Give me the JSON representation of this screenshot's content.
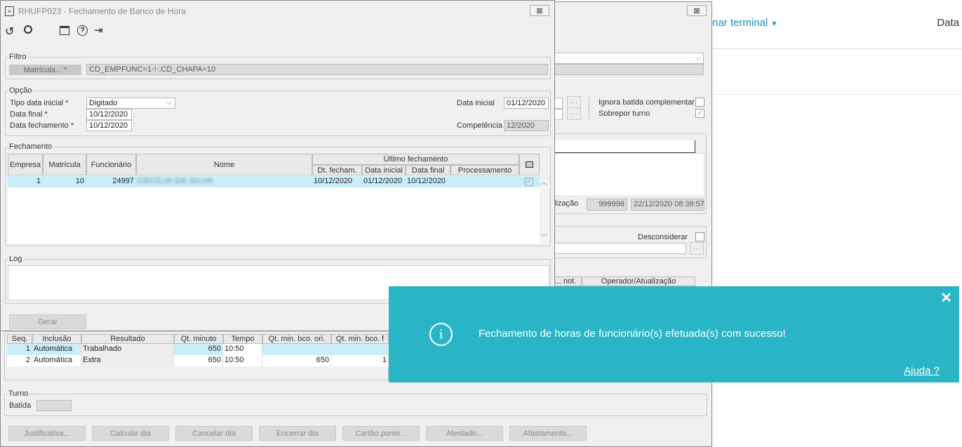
{
  "web": {
    "menu_terminal": "nar terminal",
    "menu_data": "Data"
  },
  "bgwin": {
    "close": "⊠",
    "ignora": "Ignora batida complementar",
    "sobrepor": "Sobrepor turno",
    "atualizacao_label": "lização",
    "operador": "999998",
    "data_atualizacao": "22/12/2020 08:39:57",
    "desconsiderar": "Desconsiderar",
    "col_not": "... not.",
    "col_operador": "Operador/Atualização",
    "seq_header": [
      "Seq.",
      "Inclusão",
      "Resultado",
      "Qt. minuto",
      "Tempo",
      "Qt. min. bco. ori.",
      "Qt. min. bco. f"
    ],
    "seq_rows": [
      [
        "1",
        "Automática",
        "Trabalhado",
        "650",
        "10:50",
        "",
        ""
      ],
      [
        "2",
        "Automática",
        "Extra",
        "650",
        "10:50",
        "650",
        "1"
      ]
    ],
    "turno_legend": "Turno",
    "batida": "Batida",
    "buttons": [
      "Justificativa...",
      "Calcular dia",
      "Cancelar dia",
      "Encerrar dia",
      "Cartão ponto...",
      "Atestado...",
      "Afastamento..."
    ]
  },
  "dialog": {
    "title": "RHUFP023 - Fechamento de Banco de Hora",
    "close": "⊠",
    "filtro": "Filtro",
    "matricula_label": "Matrícula... *",
    "filtro_value": "CD_EMPFUNC=1·!·;CD_CHAPA=10",
    "opcao": "Opção",
    "tipo_label": "Tipo data inicial *",
    "tipo_value": "Digitado",
    "data_final_label": "Data final *",
    "data_final": "10/12/2020",
    "data_fech_label": "Data fechamento *",
    "data_fech": "10/12/2020",
    "data_inicial_label": "Data inicial",
    "data_inicial": "01/12/2020",
    "competencia_label": "Competência",
    "competencia": "12/2020",
    "fechamento": "Fechamento",
    "cols": {
      "empresa": "Empresa",
      "matricula": "Matrícula",
      "funcionario": "Funcionário",
      "nome": "Nome",
      "ultimo": "Último fechamento",
      "dt_fecham": "Dt. fecham.",
      "data_inicial": "Data inicial",
      "data_final": "Data final",
      "processamento": "Processamento"
    },
    "row": {
      "empresa": "1",
      "matricula": "10",
      "funcionario": "24997",
      "nome": "CECÍLIA DA SILVA",
      "dt_fecham": "10/12/2020",
      "data_inicial": "01/12/2020",
      "data_final": "10/12/2020",
      "processamento": ""
    },
    "log": "Log",
    "gerar": "Gerar"
  },
  "toast": {
    "message": "Fechamento de horas de funcionário(s) efetuada(s) com sucesso!",
    "help": "Ajuda ?",
    "close": "✕"
  }
}
